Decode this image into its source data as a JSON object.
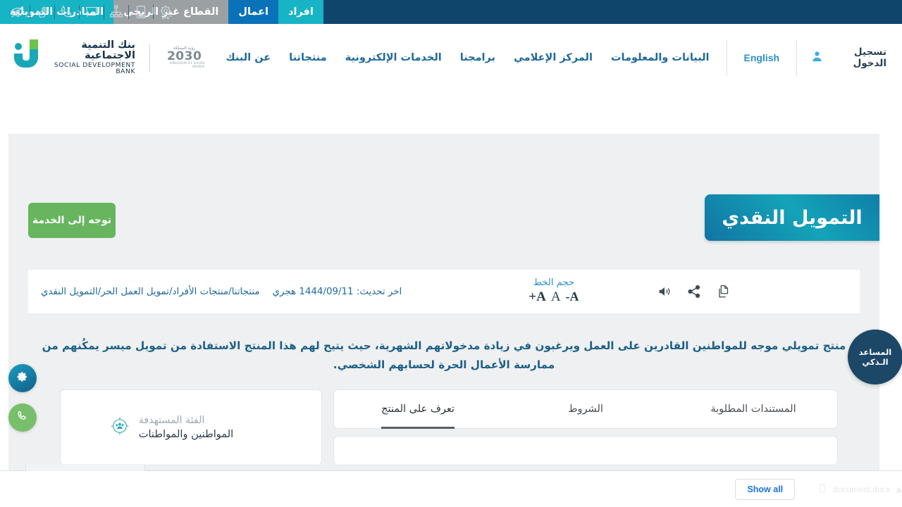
{
  "topbar": {
    "tabs": [
      {
        "label": "افراد",
        "bg": "#16b4c4",
        "color": "#ffffff"
      },
      {
        "label": "اعمال",
        "bg": "#0a72b8",
        "color": "#ffffff"
      },
      {
        "label": "القطاع غير الربحي",
        "bg": "#9ba0a3",
        "color": "#ffffff"
      },
      {
        "label": "المبادرات التمويلية",
        "bg": "#16b4c4",
        "color": "#ffffff"
      }
    ],
    "accessibility_icons": [
      "eye-off-icon",
      "sign-language-icon",
      "phone-icon",
      "screen-icon",
      "sitemap-icon",
      "mobile-icon",
      "award-icon"
    ],
    "background": "#10456b"
  },
  "header": {
    "logo": {
      "name_ar": "بنك التنمية الاجتماعية",
      "name_en": "SOCIAL DEVELOPMENT BANK",
      "vision_top": "رؤية المملكة",
      "vision_number": "2030",
      "vision_bottom": "KINGDOM OF SAUDI ARABIA"
    },
    "nav": [
      "عن البنك",
      "منتجاتنا",
      "الخدمات الإلكترونية",
      "برامجنا",
      "المركز الإعلامي",
      "البيانات والمعلومات"
    ],
    "language_toggle": "English",
    "login_label": "تسجيل الدخول",
    "nav_color": "#1f6a9c"
  },
  "hero": {
    "title": "التمويل النقدي",
    "cta_label": "توجه إلى الخدمة",
    "cta_color": "#67b55e",
    "title_gradient_from": "#14a3b8",
    "title_gradient_to": "#1174a3"
  },
  "infobar": {
    "breadcrumb": "منتجاتنا/منتجات الأفراد/تمويل العمل الحر/التمويل النقدي",
    "last_updated": "اخر تحديث: 1444/09/11 هجري",
    "font_size_label": "حجم الخط",
    "font_decrease": "A-",
    "font_normal": "A",
    "font_increase": "A+",
    "action_icons": [
      "speaker-icon",
      "share-icon",
      "copy-icon"
    ]
  },
  "description": "منتج تمويلي موجه للمواطنين القادرين على العمل ويرغبون في زيادة مدخولاتهم الشهرية، حيث يتيح لهم هذا المنتج الاستفادة من تمويل ميسر يمكُنهم من ممارسة الأعمال الحرة لحسابهم الشخصي.",
  "tabs": [
    {
      "label": "تعرف على المنتج",
      "active": true
    },
    {
      "label": "الشروط",
      "active": false
    },
    {
      "label": "المستندات المطلوبة",
      "active": false
    }
  ],
  "target_category": {
    "label": "الفئة المستهدفة",
    "value": "المواطنين والمواطنات",
    "icon": "target-users-icon"
  },
  "floating": {
    "settings_icon": "gear-icon",
    "call_icon": "phone-icon",
    "assistant_line1": "المساعد",
    "assistant_line2": "الـذكي"
  },
  "download_bar": {
    "file_name": "document.docx",
    "show_all_label": "Show all"
  }
}
